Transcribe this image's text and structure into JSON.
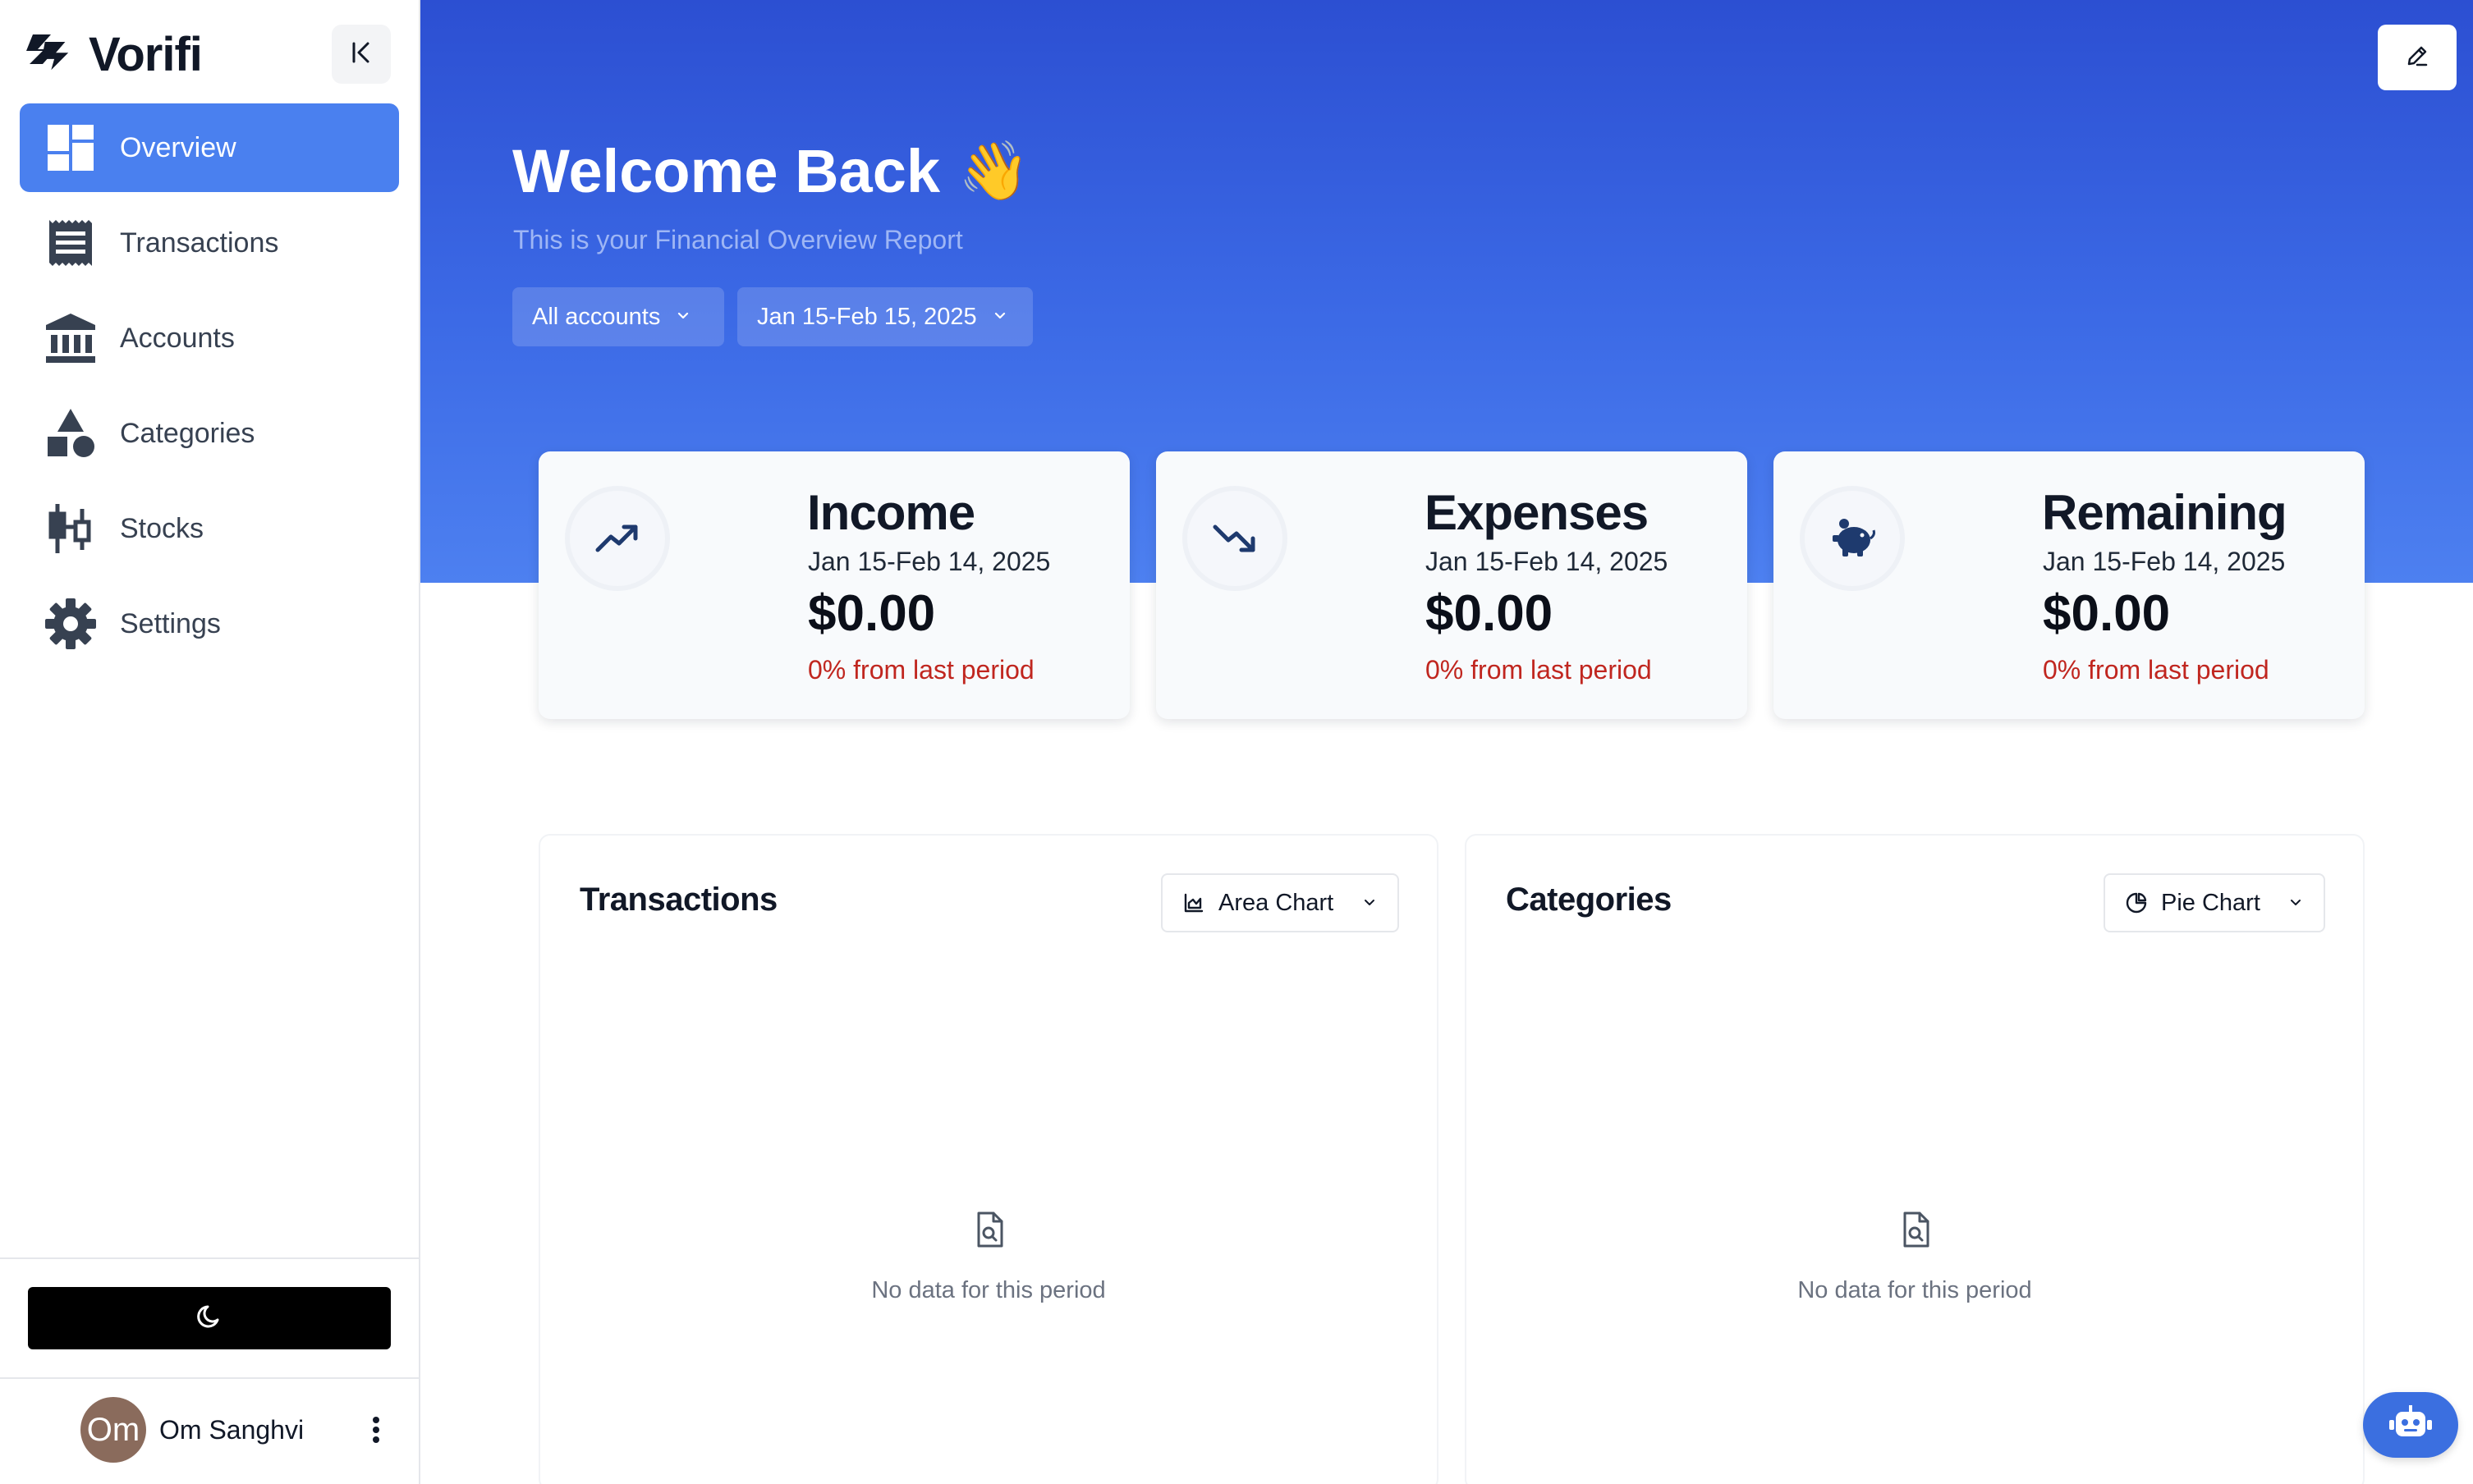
{
  "app": {
    "name": "Vorifi",
    "logo_icon": "bolt-logo-icon"
  },
  "sidebar": {
    "collapse_icon": "collapse-left-icon",
    "items": [
      {
        "label": "Overview",
        "icon": "dashboard-icon",
        "active": true
      },
      {
        "label": "Transactions",
        "icon": "receipt-icon",
        "active": false
      },
      {
        "label": "Accounts",
        "icon": "bank-icon",
        "active": false
      },
      {
        "label": "Categories",
        "icon": "shapes-icon",
        "active": false
      },
      {
        "label": "Stocks",
        "icon": "candlestick-icon",
        "active": false
      },
      {
        "label": "Settings",
        "icon": "gear-icon",
        "active": false
      }
    ],
    "theme_toggle_icon": "moon-icon",
    "user": {
      "initials": "Om",
      "name": "Om Sanghvi",
      "menu_icon": "more-vertical-icon"
    }
  },
  "header": {
    "title": "Welcome Back",
    "emoji": "👋",
    "subtitle": "This is your Financial Overview Report",
    "edit_icon": "pencil-icon",
    "filters": {
      "account": "All accounts",
      "date_range": "Jan 15-Feb 15, 2025"
    }
  },
  "cards": [
    {
      "title": "Income",
      "range": "Jan 15-Feb 14, 2025",
      "amount": "$0.00",
      "change": "0% from last period",
      "icon": "trending-up-icon"
    },
    {
      "title": "Expenses",
      "range": "Jan 15-Feb 14, 2025",
      "amount": "$0.00",
      "change": "0% from last period",
      "icon": "trending-down-icon"
    },
    {
      "title": "Remaining",
      "range": "Jan 15-Feb 14, 2025",
      "amount": "$0.00",
      "change": "0% from last period",
      "icon": "piggy-bank-icon"
    }
  ],
  "panels": {
    "transactions": {
      "title": "Transactions",
      "chart_type": "Area Chart",
      "chart_icon": "area-chart-icon",
      "empty_text": "No data for this period",
      "empty_icon": "file-search-icon"
    },
    "categories": {
      "title": "Categories",
      "chart_type": "Pie Chart",
      "chart_icon": "pie-chart-icon",
      "empty_text": "No data for this period",
      "empty_icon": "file-search-icon"
    }
  },
  "assistant": {
    "icon": "bot-icon"
  },
  "colors": {
    "accent": "#4a80ef",
    "hero_top": "#2c4fd2",
    "hero_bottom": "#4d80f0",
    "negative": "#c0261f",
    "card_icon": "#1e3a6e"
  }
}
